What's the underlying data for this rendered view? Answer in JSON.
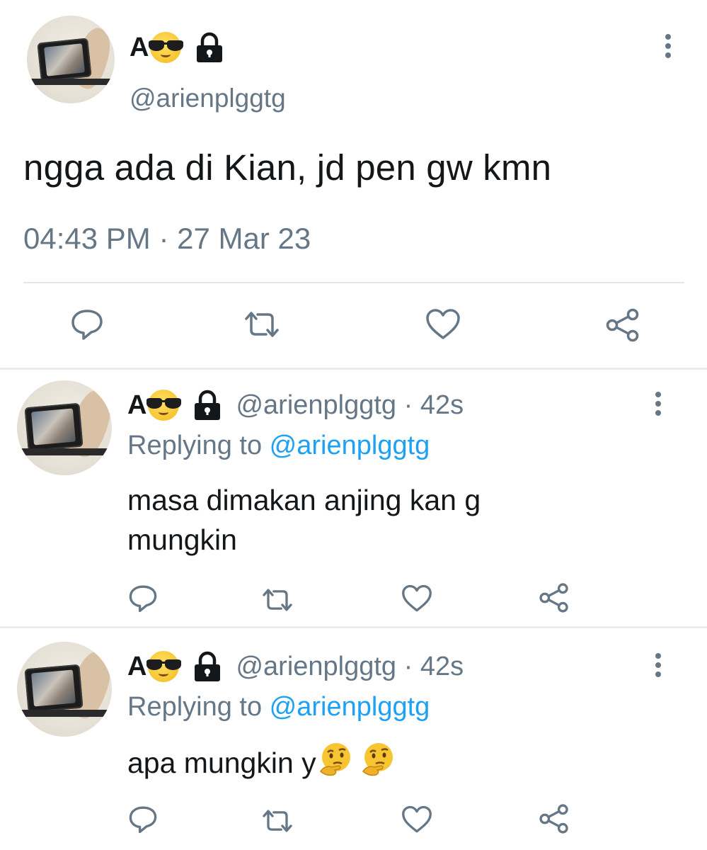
{
  "main_tweet": {
    "name": "A",
    "name_emoji": "sunglasses-face-emoji",
    "lock_icon": "lock-icon",
    "handle": "@arienplggtg",
    "text": "ngga ada di Kian, jd pen gw kmn",
    "timestamp": "04:43 PM · 27 Mar 23",
    "actions": [
      "reply-icon",
      "retweet-icon",
      "like-icon",
      "share-icon"
    ]
  },
  "replies": [
    {
      "name": "A",
      "handle": "@arienplggtg · 42s",
      "replying_label": "Replying to ",
      "replying_to": "@arienplggtg",
      "text": "masa dimakan anjing kan g mungkin"
    },
    {
      "name": "A",
      "handle": "@arienplggtg · 42s",
      "replying_label": "Replying to ",
      "replying_to": "@arienplggtg",
      "text": "apa mungkin y",
      "trailing_emojis": [
        "thinking-face-emoji",
        "thinking-face-emoji"
      ]
    }
  ],
  "colors": {
    "text": "#14171a",
    "secondary": "#657786",
    "link": "#1da1f2",
    "divider": "#e6ecf0"
  }
}
